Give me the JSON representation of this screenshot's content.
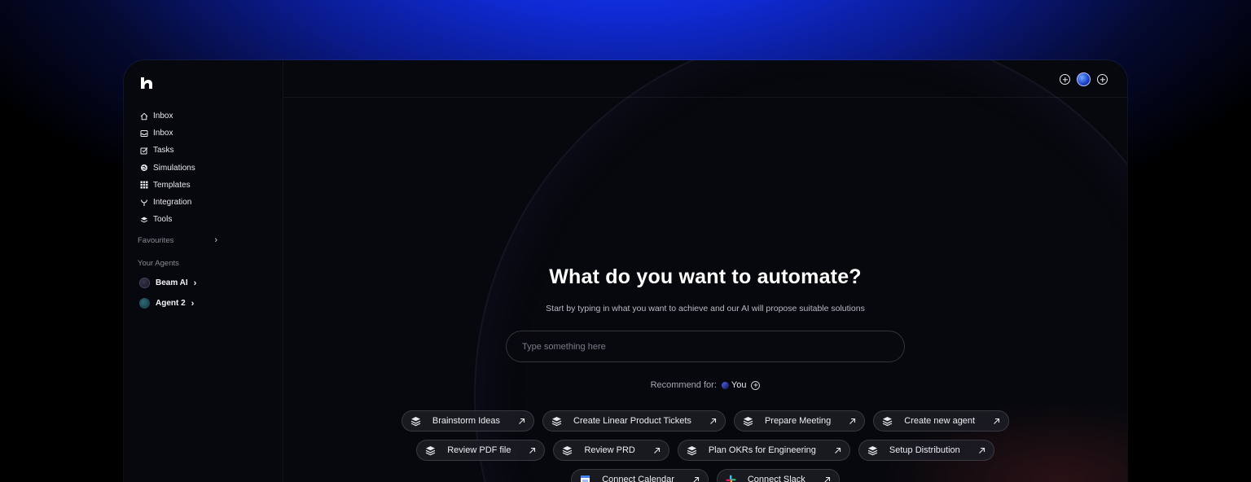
{
  "nav": {
    "items": [
      {
        "label": "Inbox",
        "icon": "home-icon"
      },
      {
        "label": "Inbox",
        "icon": "inbox-icon"
      },
      {
        "label": "Tasks",
        "icon": "tasks-icon"
      },
      {
        "label": "Simulations",
        "icon": "globe-icon"
      },
      {
        "label": "Templates",
        "icon": "grid-icon"
      },
      {
        "label": "Integration",
        "icon": "integration-icon"
      },
      {
        "label": "Tools",
        "icon": "layers-icon"
      }
    ],
    "favourites_label": "Favourites",
    "agents_label": "Your Agents",
    "agents": [
      {
        "label": "Beam AI"
      },
      {
        "label": "Agent 2"
      }
    ]
  },
  "main": {
    "title": "What do you want to automate?",
    "subtitle": "Start by typing in what you want to achieve and our AI will propose suitable solutions",
    "search_placeholder": "Type something here",
    "recommend_label": "Recommend for:",
    "recommend_target": "You",
    "chips_row1": [
      "Brainstorm Ideas",
      "Create Linear Product Tickets",
      "Prepare Meeting",
      "Create new agent"
    ],
    "chips_row2": [
      "Review PDF file",
      "Review PRD",
      "Plan OKRs for Engineering",
      "Setup Distribution"
    ],
    "chips_row3": [
      "Connect Calendar",
      "Connect Slack"
    ]
  },
  "colors": {
    "accent": "#1f47ff",
    "app_bg": "#07080d"
  }
}
